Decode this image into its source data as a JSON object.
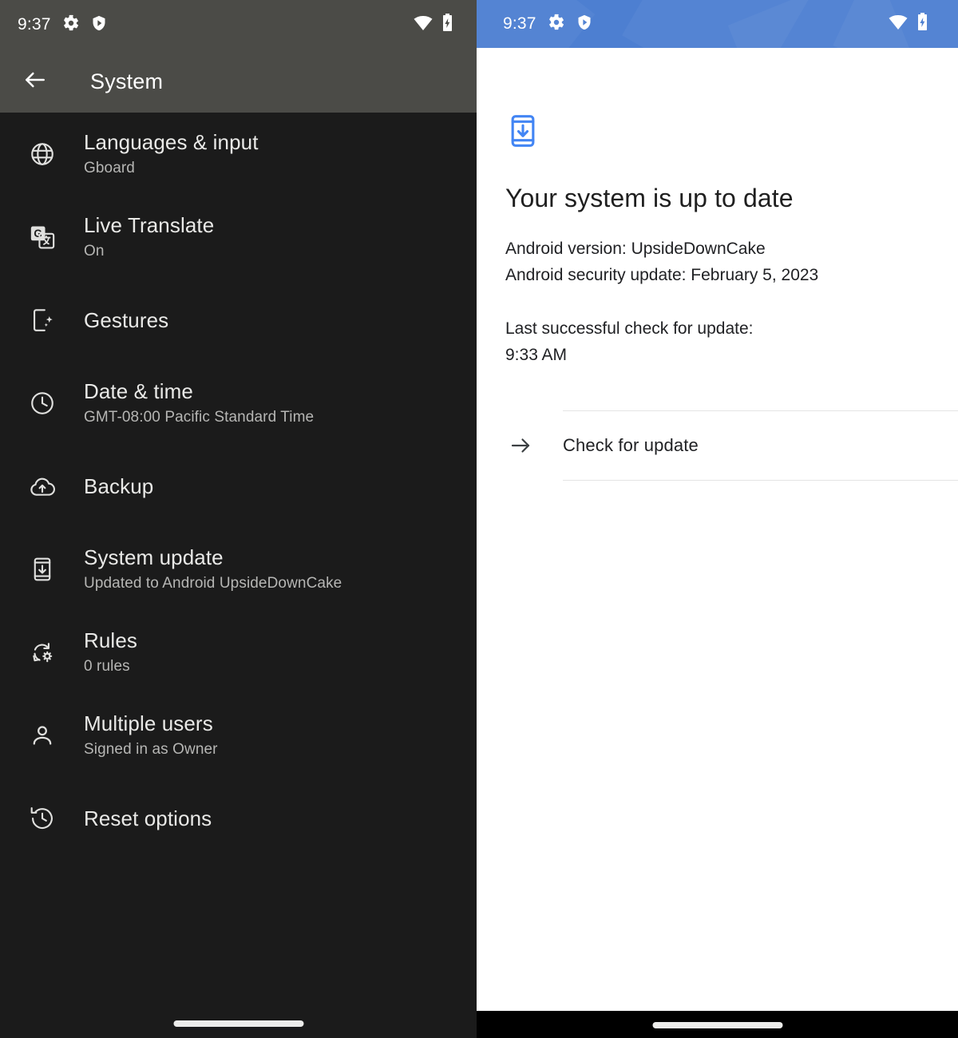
{
  "left": {
    "status_bar": {
      "clock": "9:37",
      "icons": [
        "gear-icon",
        "shield-play-icon"
      ],
      "right_icons": [
        "wifi-icon",
        "battery-charging-icon"
      ]
    },
    "app_bar": {
      "back_label": "back-arrow-icon",
      "title": "System"
    },
    "items": [
      {
        "icon": "globe-icon",
        "title": "Languages & input",
        "subtitle": "Gboard"
      },
      {
        "icon": "translate-icon",
        "title": "Live Translate",
        "subtitle": "On"
      },
      {
        "icon": "phone-sparkle-icon",
        "title": "Gestures",
        "subtitle": ""
      },
      {
        "icon": "clock-icon",
        "title": "Date & time",
        "subtitle": "GMT-08:00 Pacific Standard Time"
      },
      {
        "icon": "cloud-upload-icon",
        "title": "Backup",
        "subtitle": ""
      },
      {
        "icon": "phone-download-icon",
        "title": "System update",
        "subtitle": "Updated to Android UpsideDownCake"
      },
      {
        "icon": "rotate-gear-icon",
        "title": "Rules",
        "subtitle": "0 rules"
      },
      {
        "icon": "person-icon",
        "title": "Multiple users",
        "subtitle": "Signed in as Owner"
      },
      {
        "icon": "history-icon",
        "title": "Reset options",
        "subtitle": ""
      }
    ]
  },
  "right": {
    "status_bar": {
      "clock": "9:37",
      "icons": [
        "gear-icon",
        "shield-play-icon"
      ],
      "right_icons": [
        "wifi-icon",
        "battery-charging-icon"
      ]
    },
    "hero_icon": "system-update-phone-icon",
    "heading": "Your system is up to date",
    "version_line": "Android version: UpsideDownCake",
    "security_line": "Android security update: February 5, 2023",
    "last_check_label": "Last successful check for update:",
    "last_check_time": "9:33 AM",
    "check_action": {
      "icon": "arrow-right-icon",
      "label": "Check for update"
    }
  },
  "colors": {
    "left_appbar": "#4b4b47",
    "left_background": "#1b1b1b",
    "right_statusbar": "#4d7fd1",
    "accent_blue": "#4285f4",
    "heading_text": "#1f1f1f",
    "divider": "#e4e4e4"
  }
}
